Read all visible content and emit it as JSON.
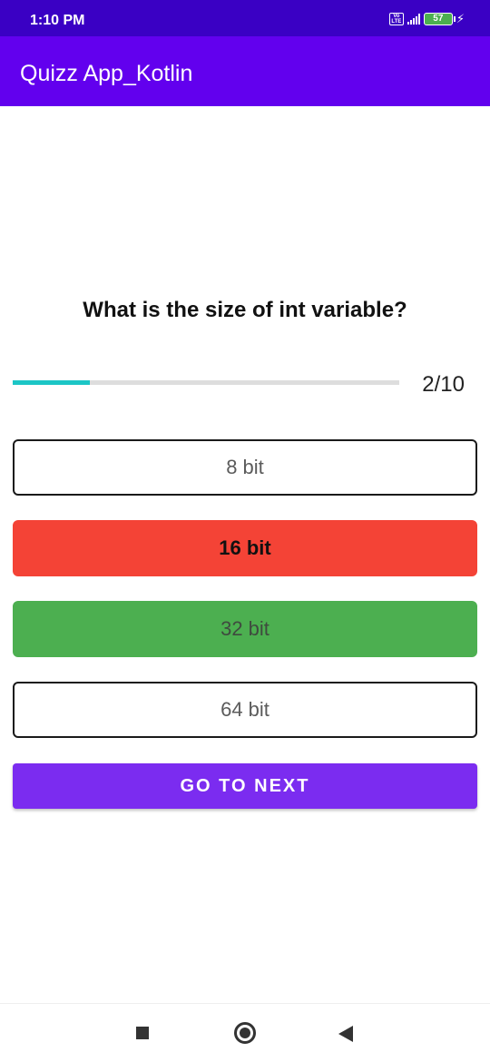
{
  "status_bar": {
    "time": "1:10 PM",
    "volte_top": "Vo",
    "volte_bottom": "LTE",
    "battery": "57",
    "icons": [
      "volte-icon",
      "signal-icon",
      "battery-icon",
      "charging-icon"
    ]
  },
  "app_bar": {
    "title": "Quizz App_Kotlin",
    "color": "#6200ee"
  },
  "quiz": {
    "question": "What is the size of int variable?",
    "progress": {
      "label": "2/10",
      "current": 2,
      "total": 10,
      "color": "#1cc6c6"
    },
    "options": [
      {
        "label": "8 bit",
        "state": "default"
      },
      {
        "label": "16 bit",
        "state": "wrong",
        "color": "#f44336"
      },
      {
        "label": "32 bit",
        "state": "correct",
        "color": "#4caf50"
      },
      {
        "label": "64 bit",
        "state": "default"
      }
    ],
    "next_label": "GO TO NEXT",
    "next_color": "#7b2cf0"
  },
  "nav_bar": {
    "icons": [
      "recents-square-icon",
      "home-circle-icon",
      "back-triangle-icon"
    ]
  }
}
